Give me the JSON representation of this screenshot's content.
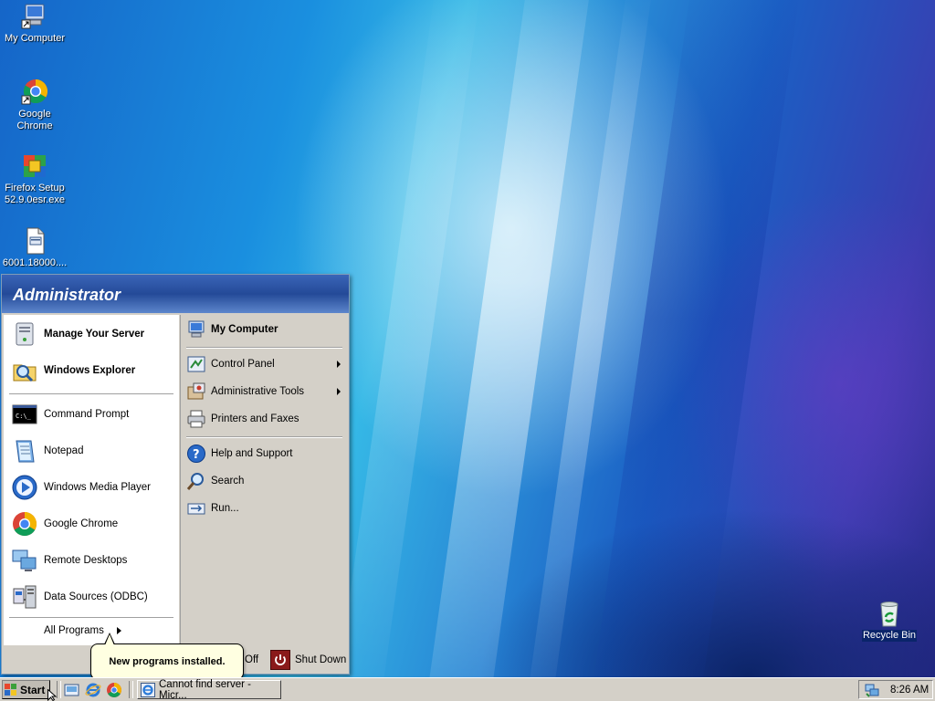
{
  "desktop": {
    "icons": [
      {
        "label": "My Computer"
      },
      {
        "label": "Google Chrome"
      },
      {
        "label": "Firefox Setup 52.9.0esr.exe"
      },
      {
        "label": "6001.18000...."
      },
      {
        "label": "Recycle Bin"
      }
    ]
  },
  "start_menu": {
    "user_name": "Administrator",
    "pinned": [
      {
        "label": "Manage Your Server",
        "icon": "server-icon"
      },
      {
        "label": "Windows Explorer",
        "icon": "explorer-icon"
      }
    ],
    "recent": [
      {
        "label": "Command Prompt",
        "icon": "cmd-icon"
      },
      {
        "label": "Notepad",
        "icon": "notepad-icon"
      },
      {
        "label": "Windows Media Player",
        "icon": "media-player-icon"
      },
      {
        "label": "Google Chrome",
        "icon": "chrome-icon"
      },
      {
        "label": "Remote Desktops",
        "icon": "remote-desktops-icon"
      },
      {
        "label": "Data Sources (ODBC)",
        "icon": "odbc-icon"
      }
    ],
    "all_programs": "All Programs",
    "right": {
      "my_computer": "My Computer",
      "control_panel": "Control Panel",
      "admin_tools": "Administrative Tools",
      "printers": "Printers and Faxes",
      "help": "Help and Support",
      "search": "Search",
      "run": "Run..."
    },
    "footer": {
      "log_off_partial": "Off",
      "shut_down": "Shut Down"
    }
  },
  "balloon": {
    "text": "New programs installed."
  },
  "taskbar": {
    "start_label": "Start",
    "task_label": "Cannot find server - Micr...",
    "clock": "8:26 AM"
  },
  "colors": {
    "menu_header": "#244a98",
    "taskbar": "#d4d0c8",
    "balloon": "#ffffe1"
  }
}
